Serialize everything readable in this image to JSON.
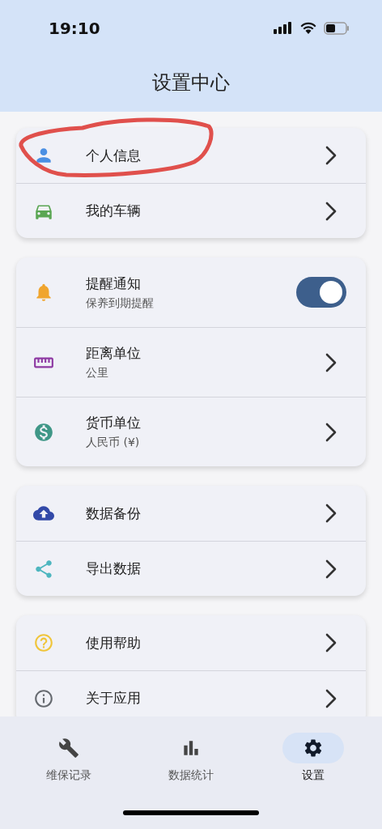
{
  "status_bar": {
    "time": "19:10"
  },
  "header": {
    "title": "设置中心"
  },
  "sections": [
    {
      "items": [
        {
          "kind": "link",
          "title": "个人信息",
          "highlighted": true
        },
        {
          "kind": "link",
          "title": "我的车辆",
          "highlighted": false
        }
      ]
    },
    {
      "items": [
        {
          "kind": "toggle",
          "title": "提醒通知",
          "subtitle": "保养到期提醒",
          "on": true,
          "highlighted": false
        },
        {
          "kind": "link",
          "title": "距离单位",
          "subtitle": "公里",
          "highlighted": false
        },
        {
          "kind": "link",
          "title": "货币单位",
          "subtitle": "人民币 (¥)",
          "highlighted": false
        }
      ]
    },
    {
      "items": [
        {
          "kind": "link",
          "title": "数据备份",
          "highlighted": false
        },
        {
          "kind": "link",
          "title": "导出数据",
          "highlighted": false
        }
      ]
    },
    {
      "items": [
        {
          "kind": "link",
          "title": "使用帮助",
          "highlighted": false
        },
        {
          "kind": "link",
          "title": "关于应用",
          "highlighted": false
        }
      ]
    }
  ],
  "bottom_nav": [
    {
      "label": "维保记录",
      "selected": false
    },
    {
      "label": "数据统计",
      "selected": false
    },
    {
      "label": "设置",
      "selected": true
    }
  ]
}
